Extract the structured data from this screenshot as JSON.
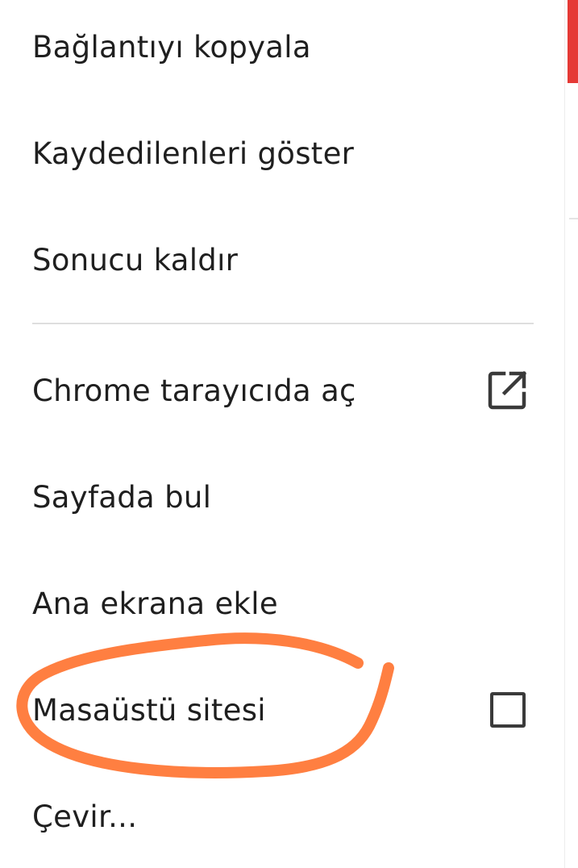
{
  "menu": {
    "items": [
      {
        "label": "Bağlantıyı kopyala"
      },
      {
        "label": "Kaydedilenleri göster"
      },
      {
        "label": "Sonucu kaldır"
      },
      {
        "label": "Chrome tarayıcıda aç",
        "icon": "open-in-new-icon"
      },
      {
        "label": "Sayfada bul"
      },
      {
        "label": "Ana ekrana ekle"
      },
      {
        "label": "Masaüstü sitesi",
        "checked": false
      },
      {
        "label": "Çevir..."
      }
    ]
  },
  "colors": {
    "annotation_stroke": "#ff7f41",
    "accent_red": "#e53935",
    "text": "#1f1f1f",
    "divider": "#dedede"
  }
}
